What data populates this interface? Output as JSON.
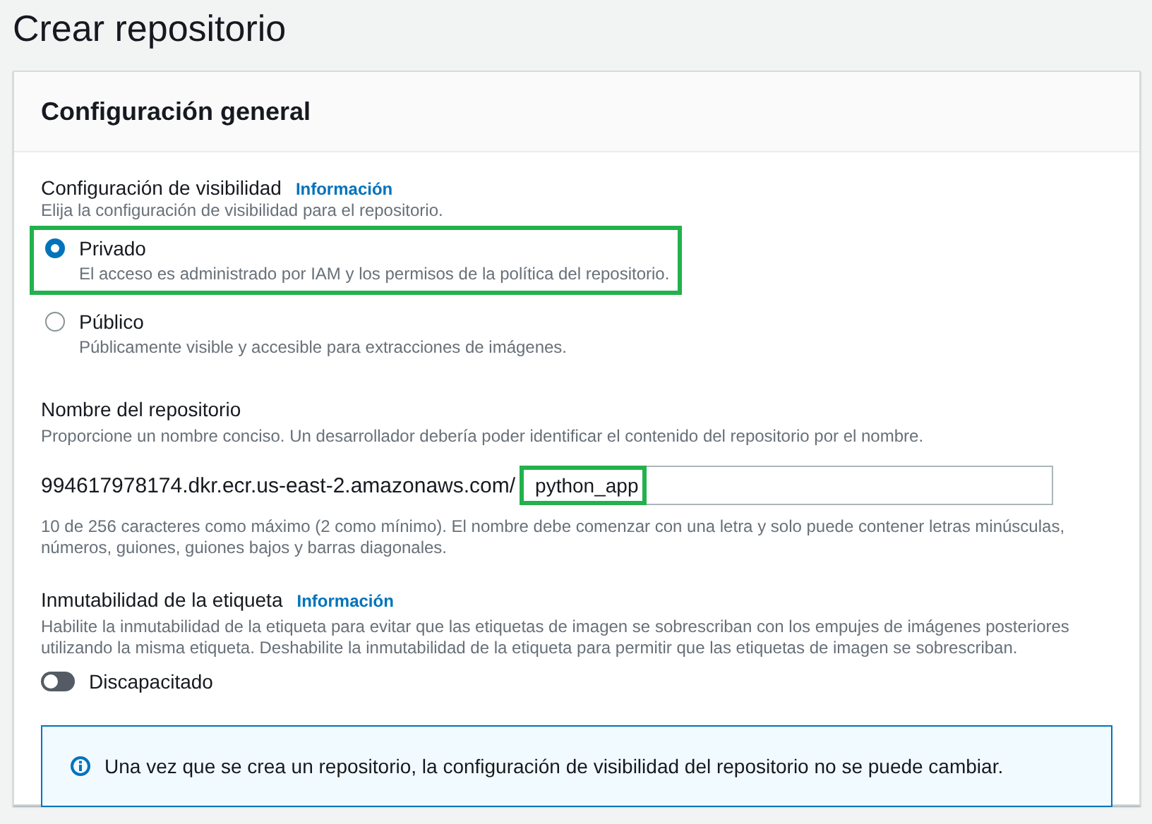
{
  "page_title": "Crear repositorio",
  "card": {
    "title": "Configuración general",
    "visibility": {
      "label": "Configuración de visibilidad",
      "info_link": "Información",
      "description": "Elija la configuración de visibilidad para el repositorio.",
      "options": [
        {
          "label": "Privado",
          "description": "El acceso es administrado por IAM y los permisos de la política del repositorio.",
          "selected": true,
          "highlighted": true
        },
        {
          "label": "Público",
          "description": "Públicamente visible y accesible para extracciones de imágenes.",
          "selected": false,
          "highlighted": false
        }
      ]
    },
    "repository_name": {
      "label": "Nombre del repositorio",
      "description": "Proporcione un nombre conciso. Un desarrollador debería poder identificar el contenido del repositorio por el nombre.",
      "prefix": "994617978174.dkr.ecr.us-east-2.amazonaws.com/",
      "value": "python_app",
      "highlighted": true,
      "constraint": "10 de 256 caracteres como máximo (2 como mínimo). El nombre debe comenzar con una letra y solo puede contener letras minúsculas, números, guiones, guiones bajos y barras diagonales."
    },
    "tag_immutability": {
      "label": "Inmutabilidad de la etiqueta",
      "info_link": "Información",
      "description": "Habilite la inmutabilidad de la etiqueta para evitar que las etiquetas de imagen se sobrescriban con los empujes de imágenes posteriores utilizando la misma etiqueta. Deshabilite la inmutabilidad de la etiqueta para permitir que las etiquetas de imagen se sobrescriban.",
      "toggle_label": "Discapacitado",
      "on": false
    },
    "info_alert": {
      "text": "Una vez que se crea un repositorio, la configuración de visibilidad del repositorio no se puede cambiar."
    }
  }
}
